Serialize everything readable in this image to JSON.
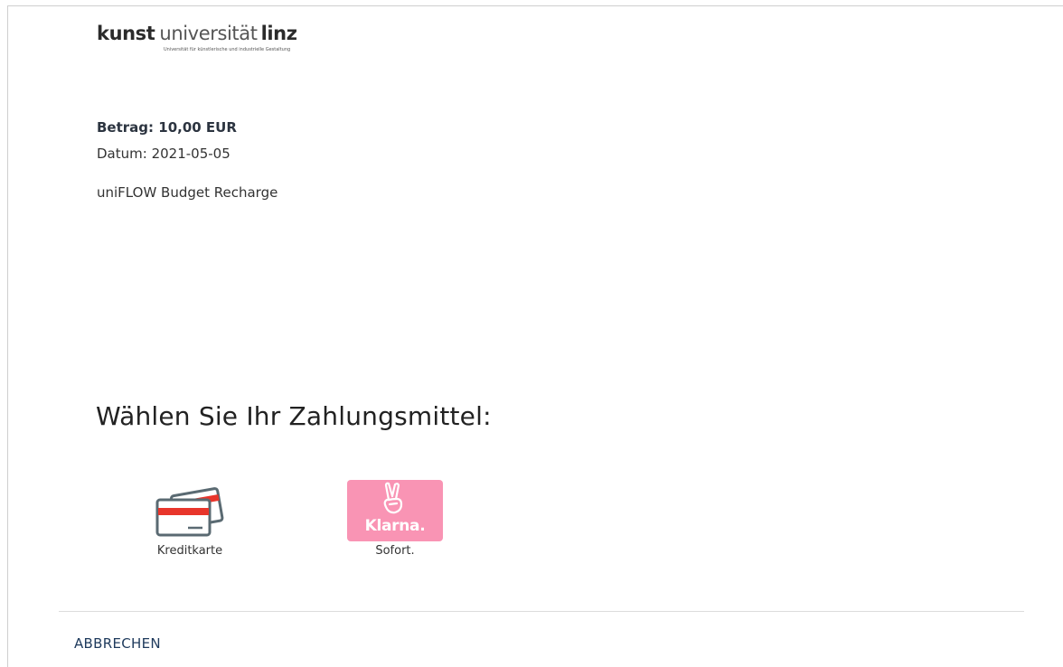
{
  "logo": {
    "word1": "kunst",
    "word2": "universität",
    "word3": "linz",
    "subtitle": "Universität für künstlerische und industrielle Gestaltung"
  },
  "payment": {
    "amount_text": "Betrag: 10,00  EUR",
    "date_text": "Datum: 2021-05-05",
    "description": "uniFLOW Budget Recharge"
  },
  "heading": "Wählen Sie Ihr Zahlungsmittel:",
  "methods": [
    {
      "label": "Kreditkarte",
      "icon": "credit-card-icon"
    },
    {
      "label": "Sofort.",
      "icon": "klarna-sofort-icon",
      "brand_text": "Klarna.",
      "brand_color": "#f994b4"
    }
  ],
  "footer": {
    "cancel_label": "ABBRECHEN"
  },
  "colors": {
    "accent_red": "#e8352b",
    "icon_gray": "#5a6a72",
    "cancel_blue": "#1e3a5c"
  }
}
